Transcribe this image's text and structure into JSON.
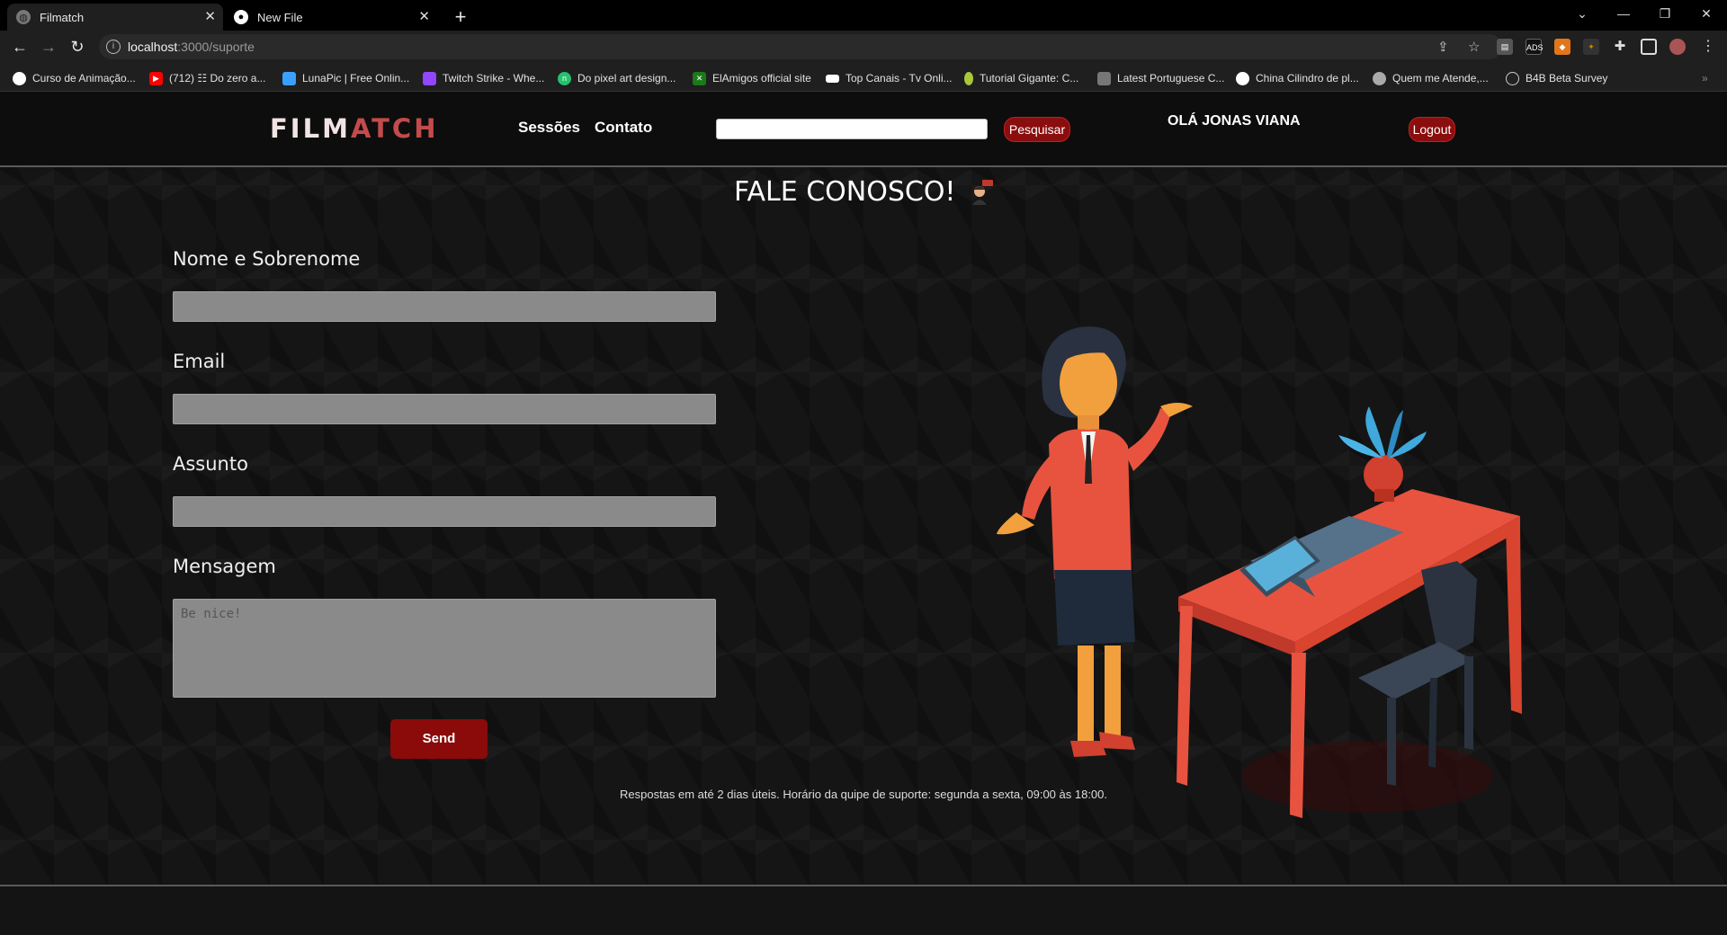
{
  "browser": {
    "tabs": [
      {
        "title": "Filmatch",
        "active": true
      },
      {
        "title": "New File",
        "active": false
      }
    ],
    "url_host": "localhost",
    "url_path": ":3000/suporte",
    "bookmarks": [
      {
        "label": "Curso de Animação...",
        "color": "#ffffff"
      },
      {
        "label": "(712) ☷ Do zero a...",
        "color": "#ff0000"
      },
      {
        "label": "LunaPic | Free Onlin...",
        "color": "#3aa0ff"
      },
      {
        "label": "Twitch Strike - Whe...",
        "color": "#9146ff"
      },
      {
        "label": "Do pixel art design...",
        "color": "#25c26e"
      },
      {
        "label": "ElAmigos official site",
        "color": "#1a7a1a"
      },
      {
        "label": "Top Canais - Tv Onli...",
        "color": "#ffffff"
      },
      {
        "label": "Tutorial Gigante: C...",
        "color": "#a8c83a"
      },
      {
        "label": "Latest Portuguese C...",
        "color": "#999999"
      },
      {
        "label": "China Cilindro de pl...",
        "color": "#ffffff"
      },
      {
        "label": "Quem me Atende,...",
        "color": "#aaaaaa"
      },
      {
        "label": "B4B Beta Survey",
        "color": "#222222"
      }
    ]
  },
  "header": {
    "logo_part1": "FILM",
    "logo_part2": "ATCH",
    "nav": [
      "Sessões",
      "Contato"
    ],
    "search_button": "Pesquisar",
    "greeting": "OLÁ JONAS VIANA",
    "logout": "Logout"
  },
  "contact": {
    "title": "FALE CONOSCO!",
    "fields": {
      "name_label": "Nome e Sobrenome",
      "email_label": "Email",
      "subject_label": "Assunto",
      "message_label": "Mensagem",
      "message_placeholder": "Be nice!"
    },
    "send": "Send",
    "note": "Respostas em até 2 dias úteis. Horário da quipe de suporte: segunda a sexta, 09:00 às 18:00."
  },
  "colors": {
    "accent": "#8b0e0e",
    "logo_red": "#c24b4b"
  }
}
